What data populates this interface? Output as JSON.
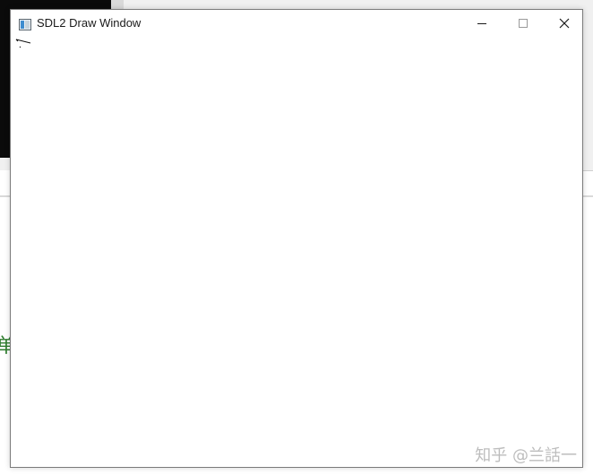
{
  "window": {
    "title": "SDL2 Draw Window",
    "controls": {
      "minimize": "minimize-icon",
      "maximize": "maximize-icon",
      "close": "close-icon"
    }
  },
  "background": {
    "side_char": "单"
  },
  "watermark": {
    "text": "知乎 @兰話一"
  },
  "colors": {
    "titlebar": "#ffffff",
    "canvas": "#ffffff",
    "side_char": "#2f7d2f",
    "watermark": "#bdbdbd"
  }
}
